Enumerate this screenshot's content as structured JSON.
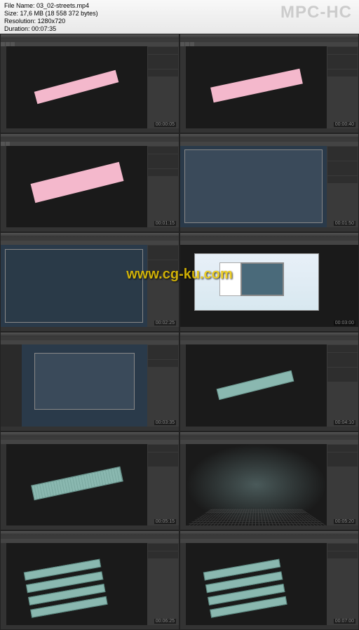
{
  "header": {
    "app_name": "MPC-HC",
    "file_label": "File Name:",
    "file_name": "03_02-streets.mp4",
    "size_label": "Size:",
    "size_value": "17,6 MB (18 558 372 bytes)",
    "resolution_label": "Resolution:",
    "resolution_value": "1280x720",
    "duration_label": "Duration:",
    "duration_value": "00:07:35"
  },
  "watermark": "www.cg-ku.com",
  "timestamps": [
    "00:00:05",
    "00:00:40",
    "00:01:15",
    "00:01:50",
    "00:02:25",
    "00:03:00",
    "00:03:35",
    "00:04:10",
    "00:05:15",
    "00:05:20",
    "00:06:25",
    "00:07:00"
  ]
}
